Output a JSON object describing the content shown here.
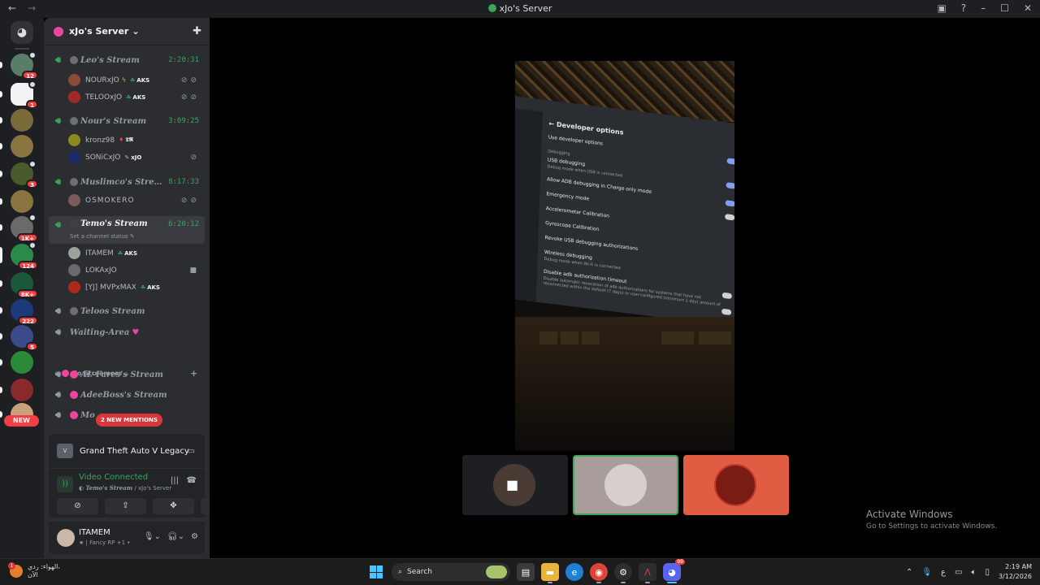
{
  "titlebar": {
    "title": "xJo's Server",
    "back": "←",
    "forward": "→",
    "help": "?",
    "minimize": "–",
    "maximize": "☐",
    "close": "✕"
  },
  "rail": {
    "servers": [
      {
        "badge": "12",
        "color": "#5a7d6a"
      },
      {
        "badge": "1",
        "color": "#f2f3f5"
      },
      {
        "badge": "",
        "color": "#7a6a3a"
      },
      {
        "badge": "",
        "color": "#8a7440"
      },
      {
        "badge": "3",
        "color": "#4a5a2a"
      },
      {
        "badge": "",
        "color": "#8a7440"
      },
      {
        "badge": "1K+",
        "color": "#6a6a6a"
      },
      {
        "badge": "124",
        "color": "#2a8a4a"
      },
      {
        "badge": "8K+",
        "color": "#1a5a3a"
      },
      {
        "badge": "222",
        "color": "#1a3a7a"
      },
      {
        "badge": "5",
        "color": "#3a4a8a"
      },
      {
        "badge": "",
        "color": "#2a8a3a"
      },
      {
        "badge": "",
        "color": "#8a2a2a"
      },
      {
        "badge": "",
        "color": "#c9a07a"
      }
    ],
    "new_label": "NEW"
  },
  "server": {
    "name": "xJo's Server",
    "chevron": "⌄"
  },
  "channels": {
    "leo": {
      "name": "Leo's Stream",
      "timer": "2:20:31"
    },
    "nour": {
      "name": "Nour's Stream",
      "timer": "3:09:25"
    },
    "muslim": {
      "name": "Muslimco's Stre…",
      "timer": "8:17:33"
    },
    "temo": {
      "name": "Temo's Stream",
      "timer": "6:20:12",
      "status": "Set a channel status ✎"
    },
    "teloos": {
      "name": "Teloos Stream"
    },
    "waiting": {
      "name": "Waiting-Area"
    },
    "category": "xJo Streamers",
    "alfares": {
      "name": "AL-Fares's Stream"
    },
    "adeeboss": {
      "name": "AdeeBoss's Stream"
    },
    "partial": {
      "name": "Mo"
    }
  },
  "users": {
    "nourxjo": {
      "name": "NOURxJO",
      "tag": "AKS"
    },
    "telooxjo": {
      "name": "TELOOxJO",
      "tag": "AKS"
    },
    "kronz": {
      "name": "kronz98",
      "tag": "𝕿𝕽"
    },
    "sonic": {
      "name": "SONiCxJO",
      "tag": "xJO"
    },
    "osmoker": {
      "name": "OSMOKERO"
    },
    "itamem": {
      "name": "ITAMEM",
      "tag": "AKS"
    },
    "loka": {
      "name": "LOKAxJO"
    },
    "mvp": {
      "name": "[YJ] MVPxMAX",
      "tag": "AKS"
    }
  },
  "mentions": "2 NEW MENTIONS",
  "activity": {
    "game": "Grand Theft Auto V Legacy"
  },
  "voice": {
    "state": "Video Connected",
    "channel": "Temo's Stream",
    "server": " / xJo's Server"
  },
  "user_panel": {
    "name": "ITAMEM",
    "status": "★ | Fancy RP +1 •"
  },
  "phone_screen": {
    "header": "← Developer options",
    "use_dev": "Use developer options",
    "debugging": "Debugging",
    "usb": "USB debugging",
    "usb_sub": "Debug mode when USB is connected",
    "adb_charge": "Allow ADB debugging in Charge only mode",
    "emergency": "Emergency mode",
    "accel": "Accelerometer Calibration",
    "gyro": "Gyroscope Calibration",
    "revoke": "Revoke USB debugging authorizations",
    "wireless": "Wireless debugging",
    "wireless_sub": "Debug mode when Wi-Fi is connected",
    "disable_timeout": "Disable adb authorization timeout",
    "disable_sub": "Disable automatic revocation of adb authorizations for systems that have not reconnected within the default (7 days) or user-configured (minimum 1 day) amount of"
  },
  "watermark": {
    "title": "Activate Windows",
    "sub": "Go to Settings to activate Windows."
  },
  "taskbar": {
    "weather_line1": "الهواء: ردي،",
    "weather_line2": "الآن",
    "weather_badge": "1",
    "search": "Search",
    "discord_badge": "99",
    "lang": "ع",
    "time": "2:19 AM",
    "date": "3/12/2026"
  }
}
